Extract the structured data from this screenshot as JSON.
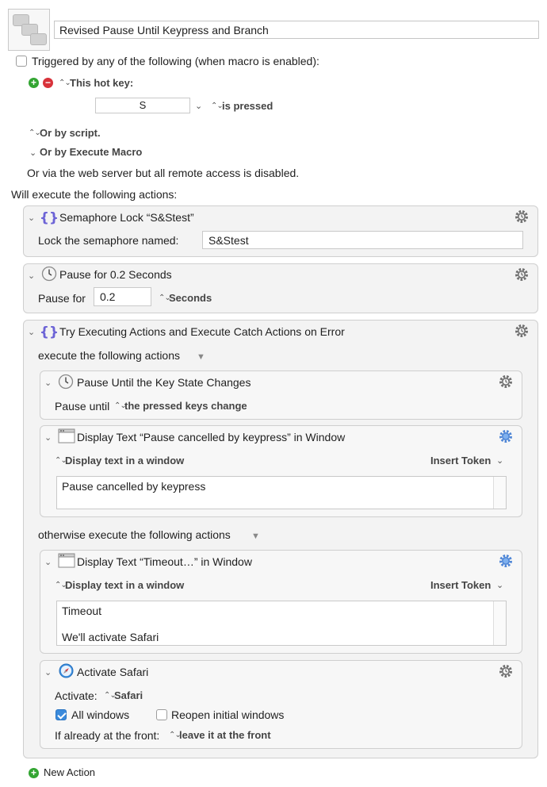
{
  "macro": {
    "name": "Revised Pause Until Keypress and Branch"
  },
  "triggers": {
    "header": "Triggered by any of the following (when macro is enabled):",
    "hotkey_label": "This hot key:",
    "hotkey_value": "S",
    "hotkey_state": "is pressed",
    "or_script": "Or by script.",
    "or_execute_macro": "Or by Execute Macro",
    "web_server_note": "Or via the web server but all remote access is disabled."
  },
  "actions_header": "Will execute the following actions:",
  "actions": {
    "semaphore": {
      "title": "Semaphore Lock “S&Stest”",
      "field_label": "Lock the semaphore named:",
      "field_value": "S&Stest"
    },
    "pause": {
      "title": "Pause for 0.2 Seconds",
      "label": "Pause for",
      "value": "0.2",
      "unit": "Seconds"
    },
    "try": {
      "title": "Try Executing Actions and Execute Catch Actions on Error",
      "execute_label": "execute the following actions",
      "otherwise_label": "otherwise execute the following actions",
      "pause_until": {
        "title": "Pause Until the Key State Changes",
        "label": "Pause until",
        "value": "the pressed keys change"
      },
      "display_cancelled": {
        "title": "Display Text “Pause cancelled by keypress” in Window",
        "mode": "Display text in a window",
        "insert_token": "Insert Token",
        "text": "Pause cancelled by keypress"
      },
      "display_timeout": {
        "title": "Display Text “Timeout…” in Window",
        "mode": "Display text in a window",
        "insert_token": "Insert Token",
        "text_line1": "Timeout",
        "text_line2": "We'll activate Safari"
      },
      "activate_safari": {
        "title": "Activate Safari",
        "activate_label": "Activate:",
        "activate_value": "Safari",
        "all_windows": "All windows",
        "reopen_windows": "Reopen initial windows",
        "front_label": "If already at the front:",
        "front_value": "leave it at the front"
      }
    }
  },
  "new_action": "New Action"
}
